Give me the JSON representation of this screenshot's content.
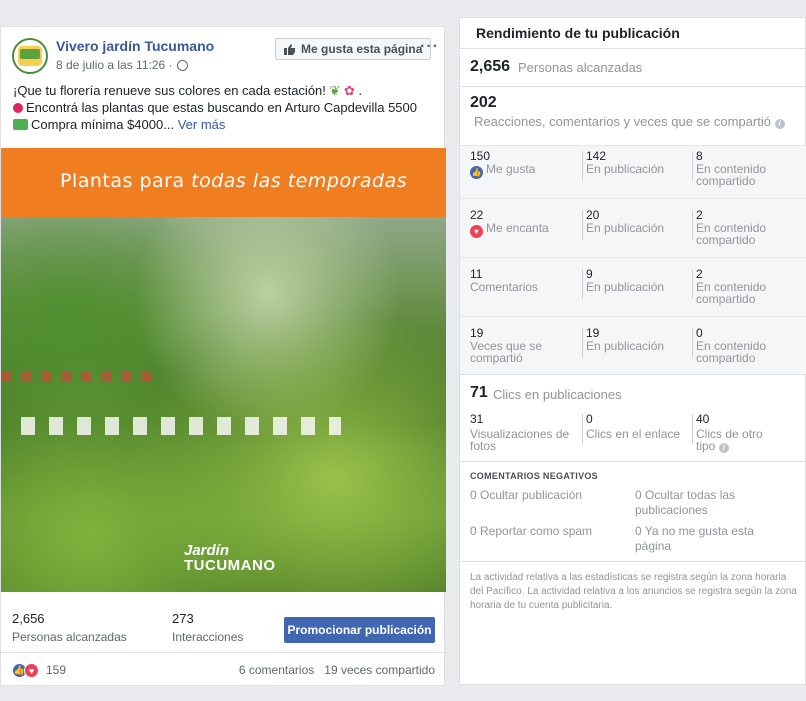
{
  "post": {
    "page_name": "Vivero jardín Tucumano",
    "timestamp": "8 de julio a las 11:26 ·",
    "like_page_label": "Me gusta esta página",
    "more_label": "···",
    "text_line1": "¡Que tu florería renueve sus colores en cada estación!",
    "text_line2": "Encontrá las plantas que estas buscando en Arturo Capdevilla 5500",
    "text_line3": "Compra mínima $4000...",
    "see_more": "Ver más",
    "image": {
      "banner_text_plain": "Plantas para ",
      "banner_text_italic": "todas las temporadas",
      "logo_line1": "Jardín",
      "logo_line2": "TUCUMANO"
    },
    "reach_value": "2,656",
    "reach_label": "Personas alcanzadas",
    "interactions_value": "273",
    "interactions_label": "Interacciones",
    "promote_label": "Promocionar publicación",
    "reactions_count": "159",
    "comments_label": "6 comentarios",
    "shares_label": "19 veces compartido"
  },
  "panel": {
    "title": "Rendimiento de tu publicación",
    "reach_value": "2,656",
    "reach_label": "Personas alcanzadas",
    "engagement_value": "202",
    "engagement_label": "Reacciones, comentarios y veces que se compartió",
    "rows": [
      {
        "v1": "150",
        "l1": "Me gusta",
        "v2": "142",
        "l2": "En publicación",
        "v3": "8",
        "l3a": "En contenido",
        "l3b": "compartido"
      },
      {
        "v1": "22",
        "l1": "Me encanta",
        "v2": "20",
        "l2": "En publicación",
        "v3": "2",
        "l3a": "En contenido",
        "l3b": "compartido"
      },
      {
        "v1": "11",
        "l1": "Comentarios",
        "v2": "9",
        "l2": "En publicación",
        "v3": "2",
        "l3a": "En contenido",
        "l3b": "compartido"
      },
      {
        "v1": "19",
        "l1a": "Veces que se",
        "l1b": "compartió",
        "v2": "19",
        "l2": "En publicación",
        "v3": "0",
        "l3a": "En contenido",
        "l3b": "compartido"
      }
    ],
    "clicks_value": "71",
    "clicks_label": "Clics en publicaciones",
    "click_cols": [
      {
        "v": "31",
        "la": "Visualizaciones de",
        "lb": "fotos"
      },
      {
        "v": "0",
        "la": "Clics en el enlace"
      },
      {
        "v": "40",
        "la": "Clics de otro",
        "lb": "tipo"
      }
    ],
    "negative_header": "COMENTARIOS NEGATIVOS",
    "negative": {
      "hide_post": "0 Ocultar publicación",
      "hide_all_a": "0 Ocultar todas las",
      "hide_all_b": "publicaciones",
      "spam": "0 Reportar como spam",
      "unlike_a": "0 Ya no me gusta esta",
      "unlike_b": "página"
    },
    "fine_print": "La actividad relativa a las estadísticas se registra según la zona horaria del Pacífico. La actividad relativa a los anuncios se registra según la zona horaria de tu cuenta publicitaria."
  },
  "colors": {
    "facebook_blue": "#4267b2",
    "link_blue": "#385898",
    "banner_orange": "#f07d1f",
    "love_red": "#f33e58"
  }
}
